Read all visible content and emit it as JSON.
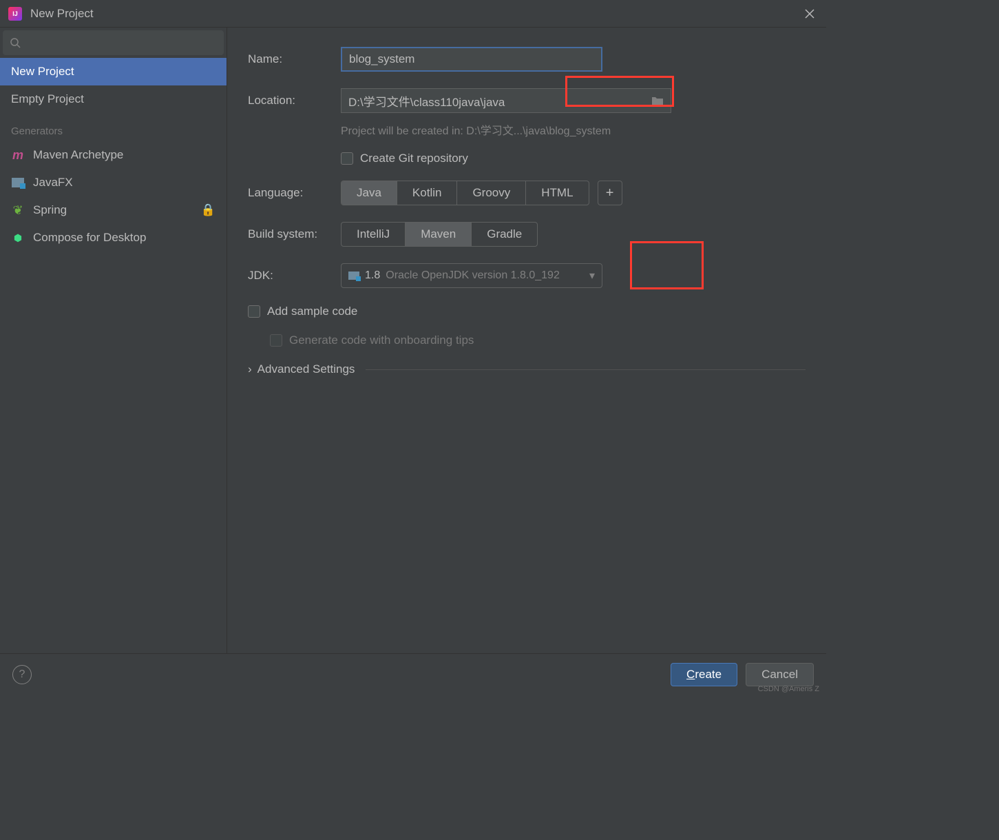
{
  "window": {
    "title": "New Project"
  },
  "sidebar": {
    "items": [
      {
        "label": "New Project"
      },
      {
        "label": "Empty Project"
      }
    ],
    "section_label": "Generators",
    "generators": [
      {
        "label": "Maven Archetype"
      },
      {
        "label": "JavaFX"
      },
      {
        "label": "Spring"
      },
      {
        "label": "Compose for Desktop"
      }
    ]
  },
  "form": {
    "name_label": "Name:",
    "name_value": "blog_system",
    "location_label": "Location:",
    "location_value": "D:\\学习文件\\class110java\\java",
    "location_hint": "Project will be created in: D:\\学习文...\\java\\blog_system",
    "git_label": "Create Git repository",
    "language_label": "Language:",
    "languages": [
      "Java",
      "Kotlin",
      "Groovy",
      "HTML"
    ],
    "language_selected": "Java",
    "build_label": "Build system:",
    "build_systems": [
      "IntelliJ",
      "Maven",
      "Gradle"
    ],
    "build_selected": "Maven",
    "jdk_label": "JDK:",
    "jdk_version": "1.8",
    "jdk_desc": "Oracle OpenJDK version 1.8.0_192",
    "sample_label": "Add sample code",
    "onboard_label": "Generate code with onboarding tips",
    "advanced_label": "Advanced Settings"
  },
  "footer": {
    "create": "Create",
    "cancel": "Cancel"
  },
  "watermark": "CSDN @Ameris Z"
}
